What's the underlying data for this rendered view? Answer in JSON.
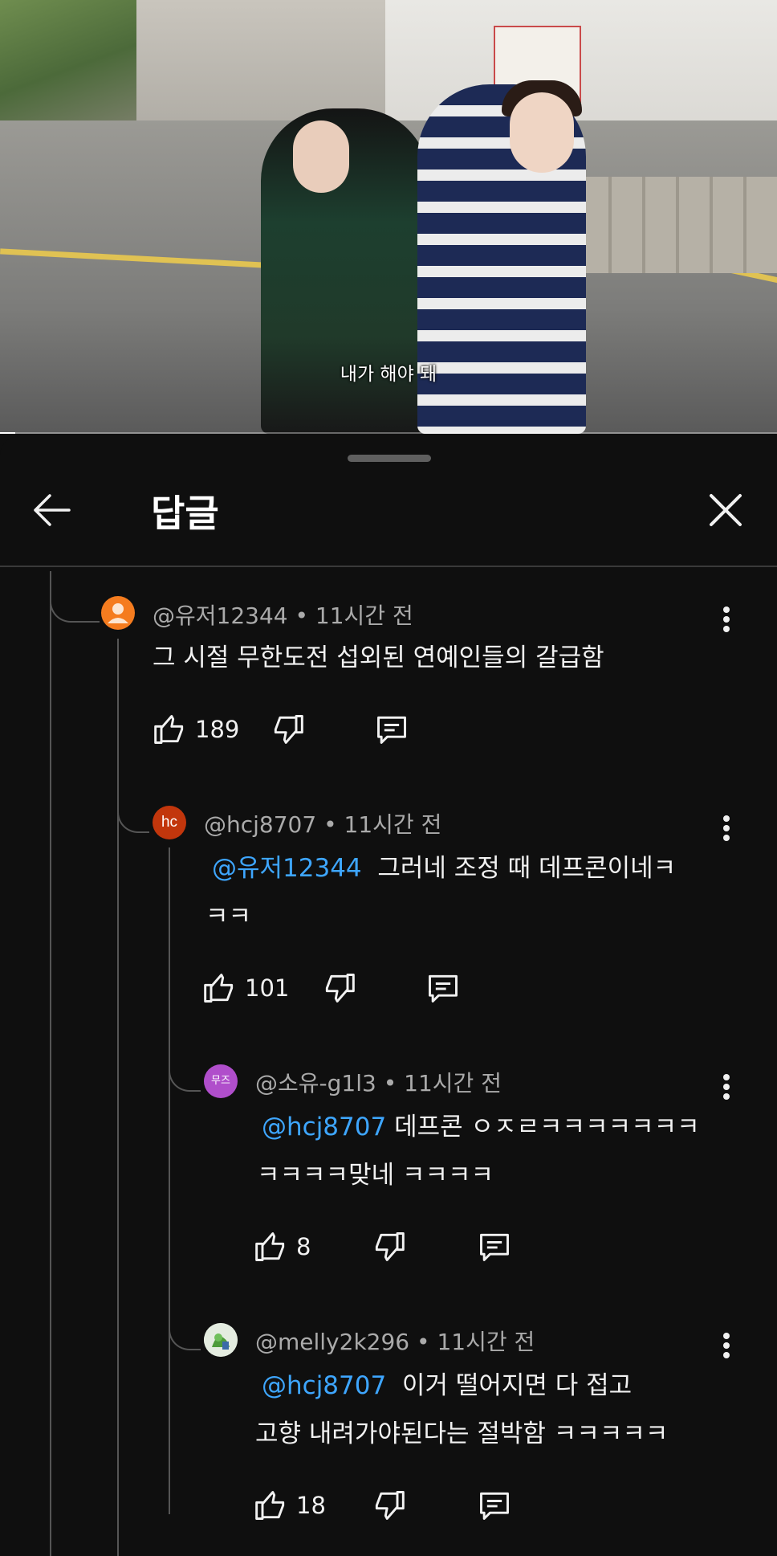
{
  "video": {
    "subtitle": "내가 해야 돼",
    "progress": 0.02
  },
  "panel": {
    "title": "답글",
    "back_icon": "arrow-left-icon",
    "close_icon": "close-icon"
  },
  "comments": [
    {
      "author": "@유저12344",
      "time": "11시간 전",
      "avatar_initials": "",
      "avatar_color": "#f57c1f",
      "mention": "",
      "text_lines": [
        "그 시절 무한도전 섭외된 연예인들의 갈급함"
      ],
      "likes": "189"
    },
    {
      "author": "@hcj8707",
      "time": "11시간 전",
      "avatar_initials": "hc",
      "avatar_color": "#c2360c",
      "mention": "@유저12344",
      "text_lines": [
        "그러네 조정 때 데프콘이네ㅋ",
        "ㅋㅋ"
      ],
      "likes": "101"
    },
    {
      "author": "@소유-g1l3",
      "time": "11시간 전",
      "avatar_initials": "무즈",
      "avatar_color": "#b04ecb",
      "mention": "@hcj8707",
      "text_lines": [
        "데프콘 ㅇㅈㄹㅋㅋㅋㅋㅋㅋㅋ",
        "ㅋㅋㅋㅋ맞네 ㅋㅋㅋㅋ"
      ],
      "likes": "8"
    },
    {
      "author": "@melly2k296",
      "time": "11시간 전",
      "avatar_initials": "",
      "avatar_color": "#dfe8d8",
      "mention": "@hcj8707",
      "text_lines": [
        "이거 떨어지면 다 접고",
        "고향 내려가야된다는 절박함 ㅋㅋㅋㅋㅋ"
      ],
      "likes": "18"
    }
  ],
  "separator": "•",
  "colors": {
    "background": "#0f0f0f",
    "mention": "#3ea6ff",
    "meta_text": "#aaaaaa",
    "thread_line": "#555555"
  },
  "icons": {
    "like": "thumbs-up-icon",
    "dislike": "thumbs-down-icon",
    "reply": "reply-icon",
    "more": "more-vert-icon"
  }
}
